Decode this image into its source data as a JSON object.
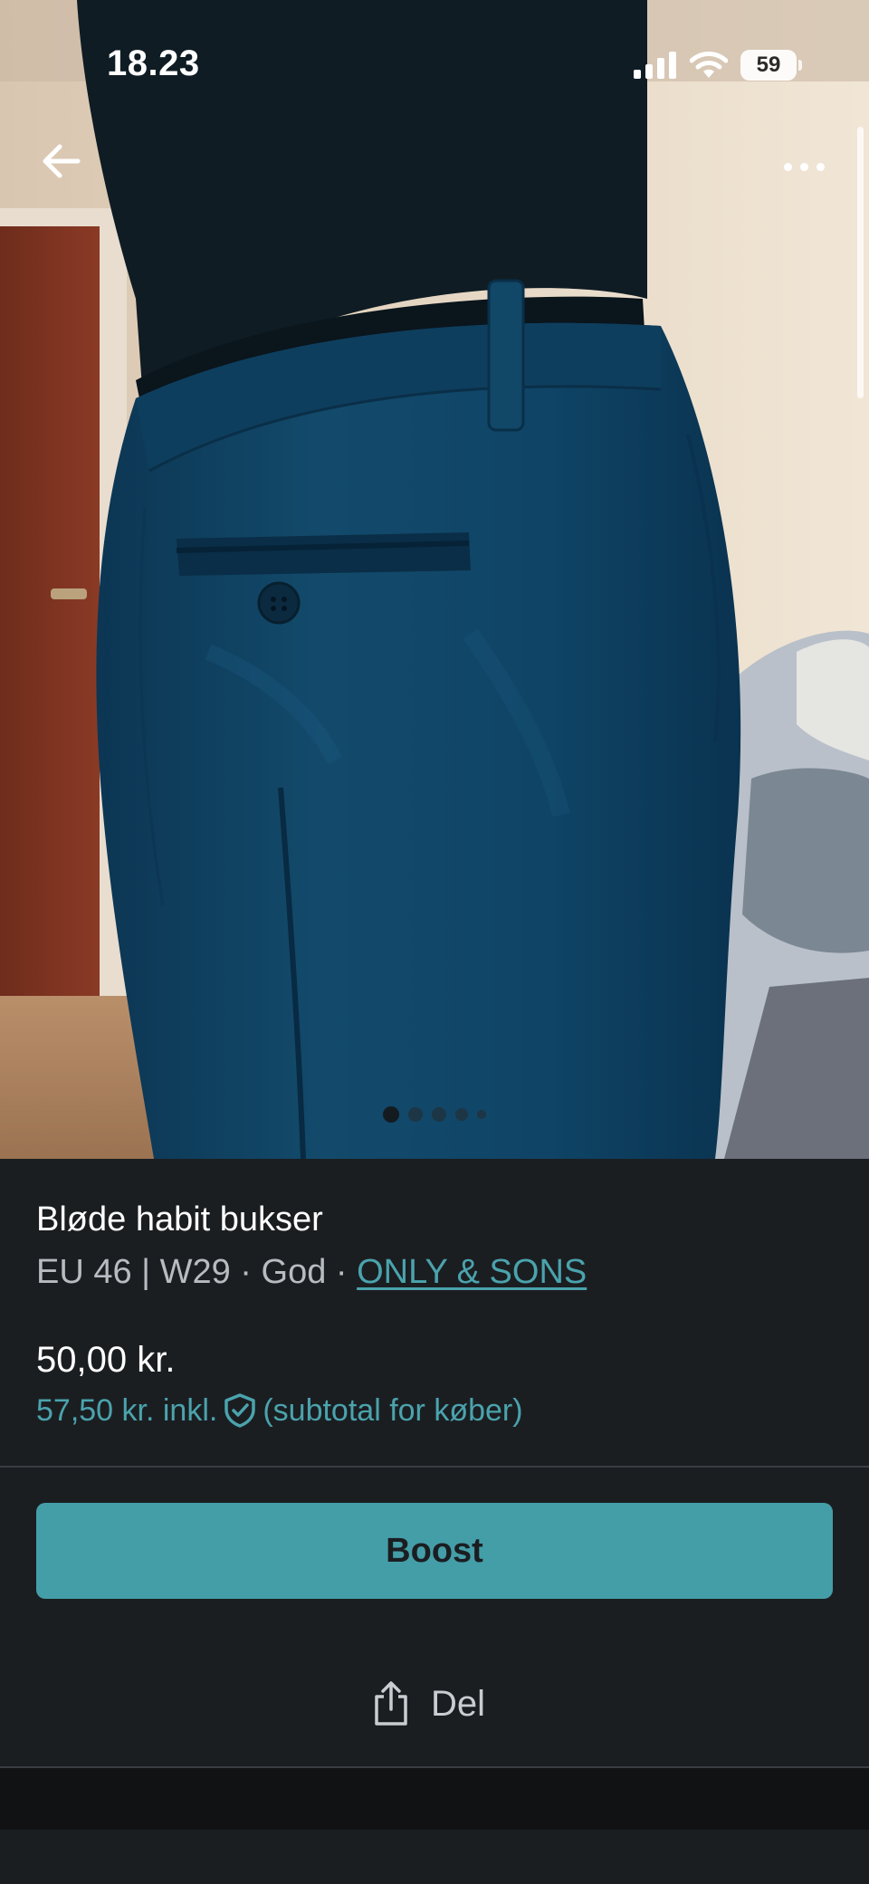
{
  "status_bar": {
    "time": "18.23",
    "battery_level": "59",
    "icons": [
      "cellular-signal-icon",
      "wifi-icon",
      "battery-icon"
    ]
  },
  "top_bar": {
    "back_icon": "arrow-left-icon",
    "more_icon": "more-horizontal-icon"
  },
  "gallery": {
    "image_count": 5,
    "active_index": 0
  },
  "listing": {
    "title": "Bløde habit bukser",
    "size": "EU 46 | W29",
    "separator": " · ",
    "condition": "God",
    "brand": "ONLY & SONS",
    "price": "50,00 kr.",
    "buyer_price": "57,50 kr. inkl.",
    "buyer_note": "(subtotal for køber)"
  },
  "actions": {
    "boost_label": "Boost",
    "share_label": "Del"
  },
  "colors": {
    "accent": "#449ea8",
    "link": "#4aa3ad",
    "background": "#1b1e21",
    "muted_text": "#b7bcc1"
  }
}
